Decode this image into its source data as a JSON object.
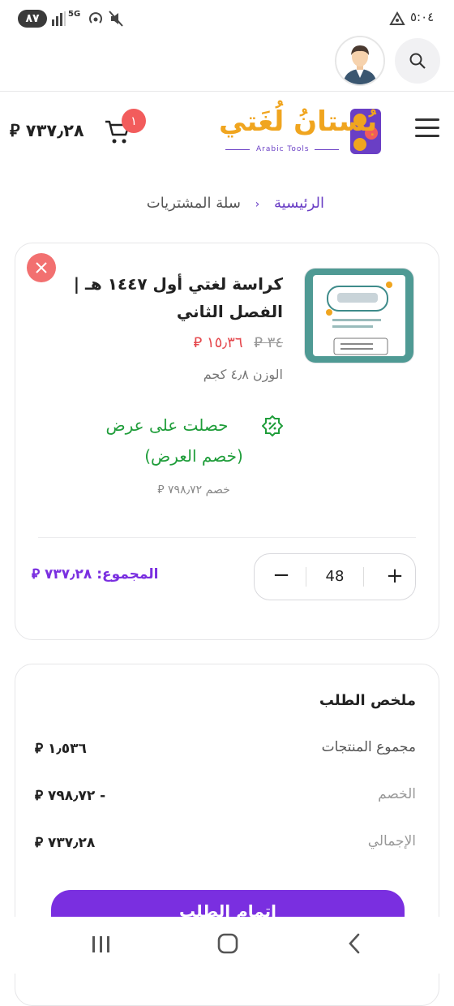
{
  "status_bar": {
    "time": "٥:٠٤",
    "battery": "٨٧",
    "network": "5G"
  },
  "header": {
    "logo_title": "بُستانُ لُغَتي",
    "logo_sub": "Arabic Tools",
    "cart_count": "١",
    "cart_total": "٧٣٧٫٢٨ ⃁"
  },
  "breadcrumb": {
    "home": "الرئيسية",
    "current": "سلة المشتريات"
  },
  "product": {
    "title_line1": "كراسة لغتي أول ١٤٤٧ هـ |",
    "title_line2": "الفصل الثاني",
    "old_price": "٣٤ ⃁",
    "new_price": "١٥٫٣٦ ⃁",
    "weight": "الوزن ٤٫٨ كجم",
    "offer_title": "حصلت على عرض",
    "offer_name": "(خصم العرض)",
    "discount": "خصم ٧٩٨٫٧٢ ⃁",
    "quantity": "48",
    "total_label": "المجموع:",
    "total_value": "٧٣٧٫٢٨ ⃁"
  },
  "summary": {
    "title": "ملخص الطلب",
    "rows": [
      {
        "label": "مجموع المنتجات",
        "value": "١٫٥٣٦ ⃁"
      },
      {
        "label": "الخصم",
        "value": "- ٧٩٨٫٧٢ ⃁"
      },
      {
        "label": "الإجمالي",
        "value": "٧٣٧٫٢٨ ⃁"
      }
    ],
    "checkout_label": "اتمام الطلب"
  },
  "colors": {
    "accent": "#7a2fe0",
    "sale": "#e5484d",
    "offer": "#1f9d3a",
    "close": "#f27070"
  }
}
